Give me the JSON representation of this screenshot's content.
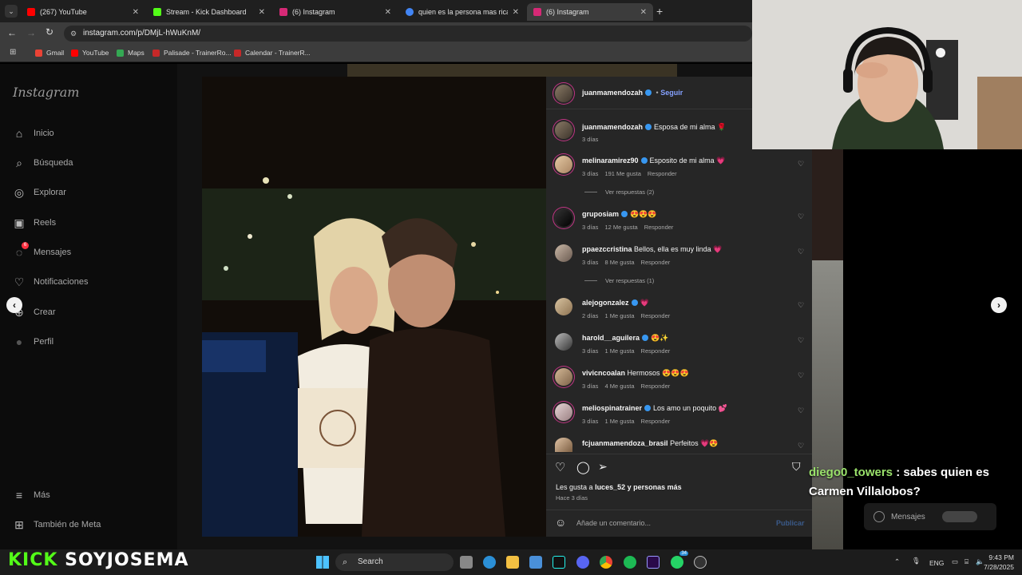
{
  "browser": {
    "tabs": [
      {
        "label": "(267) YouTube",
        "color": "#ff0000"
      },
      {
        "label": "Stream - Kick Dashboard",
        "color": "#53fc18"
      },
      {
        "label": "(6) Instagram",
        "color": "#d62976"
      },
      {
        "label": "quien es la persona mas rica de",
        "color": "#4285f4"
      },
      {
        "label": "(6) Instagram",
        "color": "#d62976"
      }
    ],
    "url": "instagram.com/p/DMjL-hWuKnM/",
    "bookmarks": [
      {
        "label": "Gmail",
        "color": "#ea4335"
      },
      {
        "label": "YouTube",
        "color": "#ff0000"
      },
      {
        "label": "Maps",
        "color": "#34a853"
      },
      {
        "label": "Palisade - TrainerRo...",
        "color": "#c62828"
      },
      {
        "label": "Calendar - TrainerR...",
        "color": "#c62828"
      }
    ]
  },
  "instagram": {
    "logo": "Instagram",
    "nav": [
      {
        "label": "Inicio",
        "icon": "home-icon",
        "glyph": "⌂"
      },
      {
        "label": "Búsqueda",
        "icon": "search-icon",
        "glyph": "⌕"
      },
      {
        "label": "Explorar",
        "icon": "compass-icon",
        "glyph": "◎"
      },
      {
        "label": "Reels",
        "icon": "reels-icon",
        "glyph": "▣"
      },
      {
        "label": "Mensajes",
        "icon": "messenger-icon",
        "glyph": "◌",
        "badge": "6"
      },
      {
        "label": "Notificaciones",
        "icon": "heart-icon",
        "glyph": "♡"
      },
      {
        "label": "Crear",
        "icon": "plus-icon",
        "glyph": "⊕"
      },
      {
        "label": "Perfil",
        "icon": "profile-icon",
        "glyph": "●"
      }
    ],
    "nav_bottom": [
      {
        "label": "Más",
        "icon": "menu-icon",
        "glyph": "≡"
      },
      {
        "label": "También de Meta",
        "icon": "meta-icon",
        "glyph": "⊞"
      }
    ],
    "post": {
      "author": "juanmamendozah",
      "follow": "Seguir",
      "caption_user": "juanmamendozah",
      "caption": "Esposa de mi alma 🌹",
      "caption_time": "3 días",
      "comments": [
        {
          "user": "melinaramirez90",
          "verified": true,
          "text": "Esposito de mi alma 💗",
          "time": "3 días",
          "likes": "191 Me gusta",
          "reply": "Responder",
          "view_replies": "Ver respuestas (2)"
        },
        {
          "user": "gruposiam",
          "verified": true,
          "text": "😍😍😍",
          "time": "3 días",
          "likes": "12 Me gusta",
          "reply": "Responder"
        },
        {
          "user": "ppaezccristina",
          "verified": false,
          "text": "Bellos, ella es muy linda 💗",
          "time": "3 días",
          "likes": "8 Me gusta",
          "reply": "Responder",
          "view_replies": "Ver respuestas (1)"
        },
        {
          "user": "alejogonzalez",
          "verified": true,
          "text": "💗",
          "time": "2 días",
          "likes": "1 Me gusta",
          "reply": "Responder"
        },
        {
          "user": "harold__aguilera",
          "verified": true,
          "text": "😍✨",
          "time": "3 días",
          "likes": "1 Me gusta",
          "reply": "Responder"
        },
        {
          "user": "vivicncoalan",
          "verified": false,
          "text": "Hermosos 😍😍😍",
          "time": "3 días",
          "likes": "4 Me gusta",
          "reply": "Responder"
        },
        {
          "user": "meliospinatrainer",
          "verified": true,
          "text": "Los amo un poquito 💕",
          "time": "3 días",
          "likes": "1 Me gusta",
          "reply": "Responder"
        },
        {
          "user": "fcjuanmamendoza_brasil",
          "verified": false,
          "text": "Perfeitos 💗😍",
          "time": "",
          "likes": "",
          "reply": ""
        }
      ],
      "likes_prefix": "Les gusta a",
      "likes_user": "luces_52",
      "likes_suffix": "y personas más",
      "posted": "Hace 3 días",
      "comment_placeholder": "Añade un comentario...",
      "publish": "Publicar"
    }
  },
  "stream": {
    "chat_user": "diego0_towers",
    "chat_text": " : sabes quien es Carmen Villalobos?",
    "messages_label": "Mensajes",
    "brand_kick": "KICK",
    "brand_name": "SOYJOSEMA"
  },
  "taskbar": {
    "search": "Search",
    "lang": "ENG",
    "time": "9:43 PM",
    "date": "7/28/2025",
    "whatsapp_badge": "34"
  }
}
